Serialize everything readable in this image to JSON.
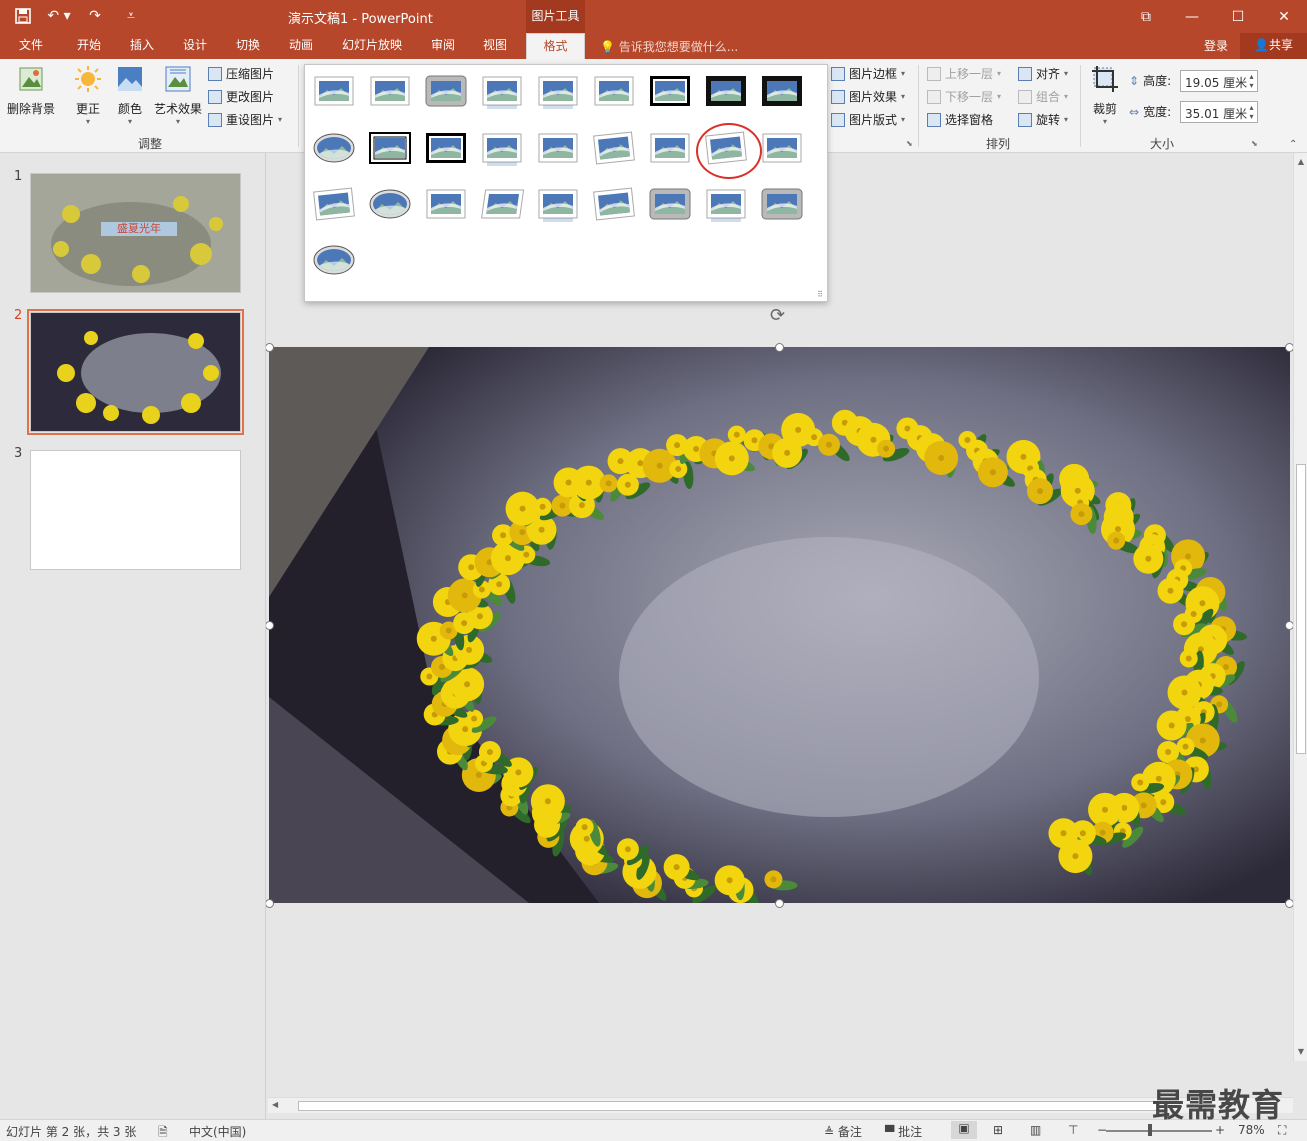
{
  "window": {
    "title": "演示文稿1 - PowerPoint",
    "tools_tab": "图片工具",
    "share": "共享",
    "login": "登录"
  },
  "tabs": [
    "文件",
    "开始",
    "插入",
    "设计",
    "切换",
    "动画",
    "幻灯片放映",
    "审阅",
    "视图",
    "格式"
  ],
  "active_tab": "格式",
  "tellme": "告诉我您想要做什么...",
  "ribbon": {
    "adjust": {
      "remove_bg": "删除背景",
      "corrections": "更正",
      "color": "颜色",
      "artistic": "艺术效果",
      "compress": "压缩图片",
      "change": "更改图片",
      "reset": "重设图片",
      "label": "调整"
    },
    "styles": {
      "border": "图片边框",
      "effects": "图片效果",
      "layout": "图片版式"
    },
    "arrange": {
      "bring_forward": "上移一层",
      "send_backward": "下移一层",
      "selection_pane": "选择窗格",
      "align": "对齐",
      "group": "组合",
      "rotate": "旋转",
      "label": "排列"
    },
    "size": {
      "crop": "裁剪",
      "height_label": "高度:",
      "height_value": "19.05 厘米",
      "width_label": "宽度:",
      "width_value": "35.01 厘米",
      "label": "大小"
    }
  },
  "slides": [
    {
      "number": "1",
      "title_text": "盛夏光年"
    },
    {
      "number": "2"
    },
    {
      "number": "3"
    }
  ],
  "status": {
    "slide_info": "幻灯片 第 2 张，共 3 张",
    "language": "中文(中国)",
    "notes": "备注",
    "comments": "批注",
    "zoom": "78%"
  },
  "watermark": "最需教育",
  "colors": {
    "accent": "#b7472a",
    "highlight": "#d9302b"
  }
}
